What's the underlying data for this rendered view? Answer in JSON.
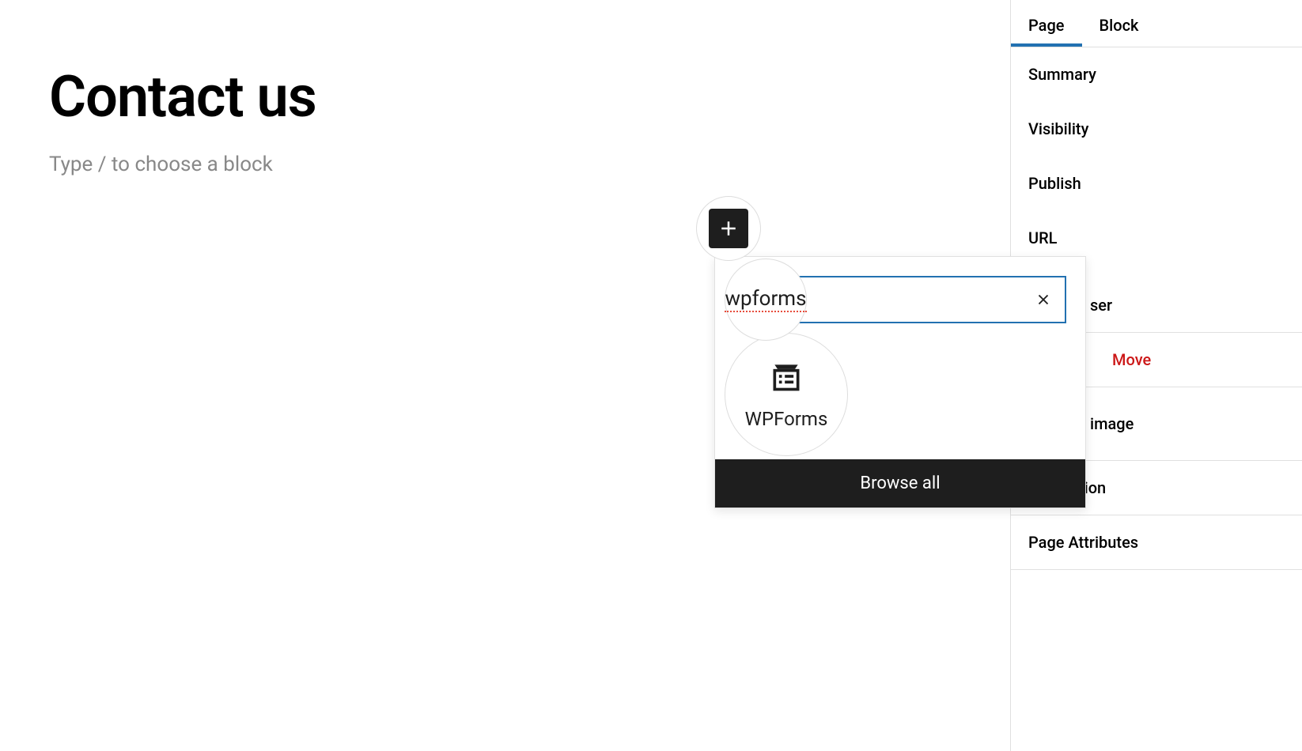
{
  "editor": {
    "title": "Contact us",
    "placeholder": "Type / to choose a block"
  },
  "sidebar": {
    "tabs": {
      "page": "Page",
      "block": "Block"
    },
    "panels": {
      "summary": "Summary",
      "visibility": "Visibility",
      "publish": "Publish",
      "url": "URL",
      "ser_partial": "ser",
      "move": "Move",
      "image_partial": "image",
      "discussion": "Discussion",
      "page_attributes": "Page Attributes"
    }
  },
  "block_picker": {
    "search_value": "wpforms",
    "result_name": "WPForms",
    "browse_all": "Browse all",
    "clear_label": "×"
  }
}
